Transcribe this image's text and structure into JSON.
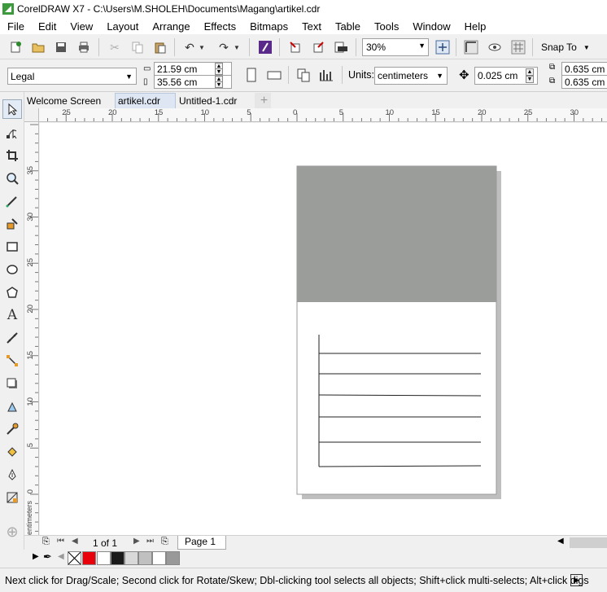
{
  "window": {
    "title": "CorelDRAW X7 - C:\\Users\\M.SHOLEH\\Documents\\Magang\\artikel.cdr"
  },
  "menu": [
    "File",
    "Edit",
    "View",
    "Layout",
    "Arrange",
    "Effects",
    "Bitmaps",
    "Text",
    "Table",
    "Tools",
    "Window",
    "Help"
  ],
  "toolbar": {
    "zoom_value": "30%",
    "snap_label": "Snap To"
  },
  "property_bar": {
    "page_size": "Legal",
    "width": "21.59 cm",
    "height": "35.56 cm",
    "units_label": "Units:",
    "units_value": "centimeters",
    "nudge": "0.025 cm",
    "dup_x": "0.635 cm",
    "dup_y": "0.635 cm"
  },
  "doc_tabs": [
    "Welcome Screen",
    "artikel.cdr",
    "Untitled-1.cdr"
  ],
  "ruler": {
    "h_labels": [
      "25",
      "20",
      "15",
      "10",
      "5",
      "0",
      "5",
      "10",
      "15",
      "20",
      "25",
      "30"
    ],
    "v_labels": [
      "35",
      "30",
      "25",
      "20",
      "15",
      "10",
      "5",
      "0"
    ],
    "v_unit": "centimeters"
  },
  "page_nav": {
    "page_counter": "1 of 1",
    "page_tab": "Page 1"
  },
  "palette": {
    "colors": [
      "#e8000b",
      "#ffffff",
      "#1a1a1a",
      "#d8d8d8",
      "#c0c0c0",
      "#ffffff",
      "#999999"
    ]
  },
  "document": {
    "header_fill": "#9b9d9b"
  },
  "status": {
    "text": "Next click for Drag/Scale; Second click for Rotate/Skew; Dbl-clicking tool selects all objects; Shift+click multi-selects; Alt+click digs"
  }
}
